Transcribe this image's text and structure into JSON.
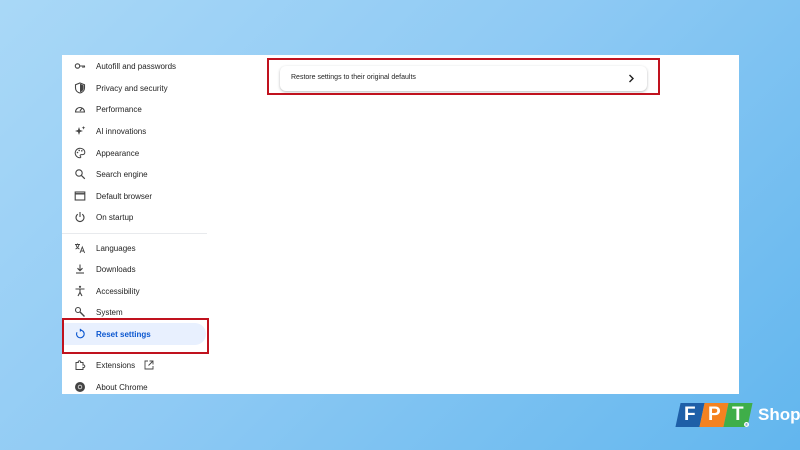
{
  "sidebar": {
    "items": [
      {
        "label": "Autofill and passwords",
        "icon": "key-icon"
      },
      {
        "label": "Privacy and security",
        "icon": "shield-icon"
      },
      {
        "label": "Performance",
        "icon": "speedometer-icon"
      },
      {
        "label": "AI innovations",
        "icon": "sparkle-icon"
      },
      {
        "label": "Appearance",
        "icon": "palette-icon"
      },
      {
        "label": "Search engine",
        "icon": "search-icon"
      },
      {
        "label": "Default browser",
        "icon": "browser-window-icon"
      },
      {
        "label": "On startup",
        "icon": "power-icon"
      },
      {
        "label": "Languages",
        "icon": "translate-icon"
      },
      {
        "label": "Downloads",
        "icon": "download-icon"
      },
      {
        "label": "Accessibility",
        "icon": "accessibility-icon"
      },
      {
        "label": "System",
        "icon": "wrench-icon"
      },
      {
        "label": "Reset settings",
        "icon": "reset-icon",
        "active": true
      },
      {
        "label": "Extensions",
        "icon": "puzzle-icon"
      },
      {
        "label": "About Chrome",
        "icon": "chrome-icon"
      }
    ]
  },
  "main": {
    "restore_label": "Restore settings to their original defaults"
  },
  "brand": {
    "logo_letters": [
      "F",
      "P",
      "T"
    ],
    "logo_word": "Shop",
    "registered_mark": "®"
  },
  "colors": {
    "highlight": "#c0121e",
    "active": "#0b57d0",
    "active_bg": "#e8f0fe",
    "logo_blue": "#1e5fa8",
    "logo_orange": "#f58220",
    "logo_green": "#3fae49"
  }
}
